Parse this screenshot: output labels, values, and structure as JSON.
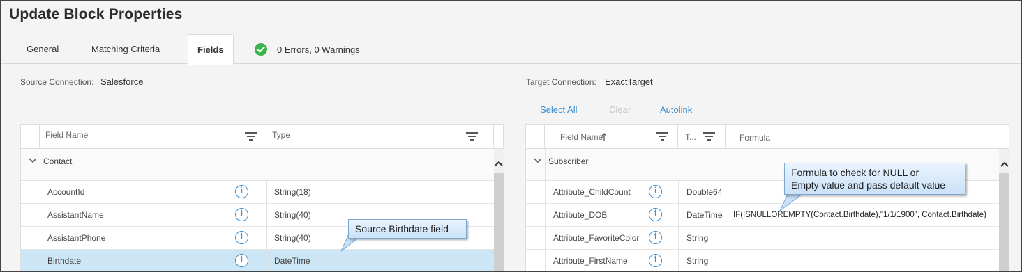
{
  "dialog": {
    "title": "Update Block Properties"
  },
  "tabs": [
    {
      "label": "General"
    },
    {
      "label": "Matching Criteria"
    },
    {
      "label": "Fields"
    }
  ],
  "status": {
    "text": "0 Errors, 0 Warnings",
    "icon": "check-circle-icon",
    "color": "#3cb44b"
  },
  "source": {
    "connection_label": "Source Connection:",
    "connection_value": "Salesforce",
    "columns": {
      "field_name": "Field Name",
      "type": "Type"
    },
    "group": "Contact",
    "rows": [
      {
        "name": "AccountId",
        "type": "String(18)"
      },
      {
        "name": "AssistantName",
        "type": "String(40)"
      },
      {
        "name": "AssistantPhone",
        "type": "String(40)"
      },
      {
        "name": "Birthdate",
        "type": "DateTime"
      }
    ]
  },
  "target": {
    "connection_label": "Target Connection:",
    "connection_value": "ExactTarget",
    "actions": {
      "select_all": "Select All",
      "clear": "Clear",
      "autolink": "Autolink"
    },
    "columns": {
      "field_name": "Field Name",
      "type": "T...",
      "formula": "Formula"
    },
    "group": "Subscriber",
    "rows": [
      {
        "name": "Attribute_ChildCount",
        "type": "Double64",
        "formula": ""
      },
      {
        "name": "Attribute_DOB",
        "type": "DateTime",
        "formula": "IF(ISNULLOREMPTY(Contact.Birthdate),\"1/1/1900\", Contact.Birthdate)"
      },
      {
        "name": "Attribute_FavoriteColor",
        "type": "String",
        "formula": ""
      },
      {
        "name": "Attribute_FirstName",
        "type": "String",
        "formula": ""
      }
    ]
  },
  "callouts": {
    "source": "Source Birthdate field",
    "formula_line1": "Formula to check for NULL or",
    "formula_line2": "Empty value and pass default value"
  },
  "colors": {
    "accent": "#3a8fd1",
    "selected_row": "#cde6f5",
    "ok": "#3cb44b"
  }
}
